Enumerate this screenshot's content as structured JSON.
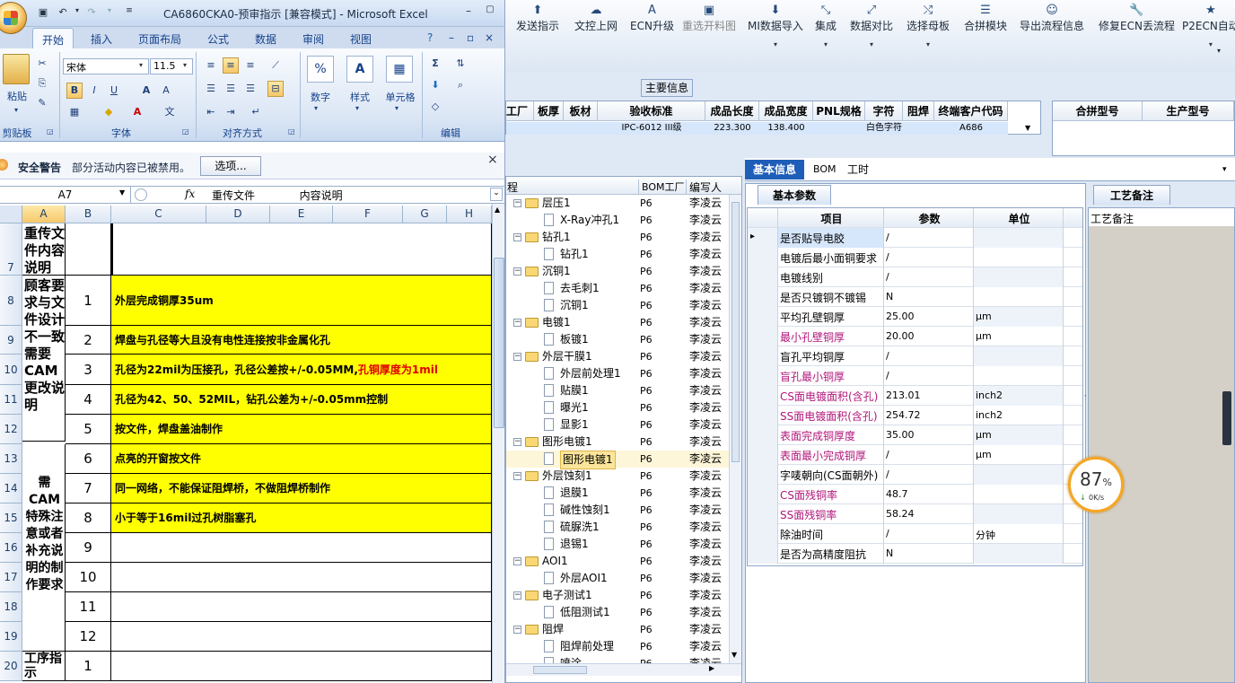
{
  "excel": {
    "title": "CA6860CKA0-预审指示  [兼容模式] - Microsoft Excel",
    "tabs": [
      "开始",
      "插入",
      "页面布局",
      "公式",
      "数据",
      "审阅",
      "视图"
    ],
    "font_name": "宋体",
    "font_size": "11.5",
    "groups": {
      "clipboard": "剪贴板",
      "font": "字体",
      "align": "对齐方式",
      "number": "数字",
      "style": "样式",
      "cells": "单元格",
      "edit": "编辑"
    },
    "paste": "粘贴",
    "security": {
      "label": "安全警告",
      "text": "部分活动内容已被禁用。",
      "button": "选项..."
    },
    "namebox": "A7",
    "fx": "fx",
    "formula": "重传文件             内容说明",
    "columns": [
      "A",
      "B",
      "C",
      "D",
      "E",
      "F",
      "G",
      "H"
    ],
    "row_numbers": [
      "7",
      "8",
      "9",
      "10",
      "11",
      "12",
      "13",
      "14",
      "15",
      "16",
      "17",
      "18",
      "19",
      "20"
    ],
    "a7": "重传文件内容说明",
    "a8": "顾客要求与文件设计不一致需要CAM更改说明",
    "a13": "需CAM特殊注意或者补充说明的制作要求",
    "a20": "工序指示",
    "numbers": [
      "1",
      "2",
      "3",
      "4",
      "5",
      "6",
      "7",
      "8",
      "9",
      "10",
      "11",
      "12",
      "1"
    ],
    "c8": "外层完成铜厚35um",
    "c9": "焊盘与孔径等大且没有电性连接按非金属化孔",
    "c10a": "孔径为22mil为压接孔，孔径公差按+/-0.05MM,",
    "c10b": "孔铜厚度为1mil",
    "c11": "孔径为42、50、52MIL，钻孔公差为+/-0.05mm控制",
    "c12": "按文件，焊盘盖油制作",
    "c13": "点亮的开窗按文件",
    "c14": "同一网络，不能保证阻焊桥，不做阻焊桥制作",
    "c15": "小于等于16mil过孔树脂塞孔"
  },
  "mes": {
    "toolbar": [
      "发送指示",
      "文控上网",
      "ECN升级",
      "重选开料图",
      "MI数据导入",
      "集成",
      "数据对比",
      "选择母板",
      "合拼模块",
      "导出流程信息",
      "修复ECN丢流程",
      "P2ECN自动"
    ],
    "main_info": "主要信息",
    "headers": [
      "工厂",
      "板厚",
      "板材",
      "验收标准",
      "成品长度",
      "成品宽度",
      "PNL规格",
      "字符",
      "阻焊",
      "终端客户代码"
    ],
    "row": [
      "",
      "",
      "",
      "IPC-6012 III级",
      "223.300",
      "138.400",
      "",
      "白色字符",
      "",
      "A686"
    ],
    "headers2": [
      "合拼型号",
      "生产型号"
    ],
    "tree_headers": [
      "程",
      "BOM工厂",
      "编写人"
    ],
    "tree": [
      {
        "n": "层压1",
        "l": 0
      },
      {
        "n": "X-Ray冲孔1",
        "l": 1
      },
      {
        "n": "钻孔1",
        "l": 0
      },
      {
        "n": "钻孔1",
        "l": 1
      },
      {
        "n": "沉铜1",
        "l": 0
      },
      {
        "n": "去毛刺1",
        "l": 1
      },
      {
        "n": "沉铜1",
        "l": 1
      },
      {
        "n": "电镀1",
        "l": 0
      },
      {
        "n": "板镀1",
        "l": 1
      },
      {
        "n": "外层干膜1",
        "l": 0
      },
      {
        "n": "外层前处理1",
        "l": 1
      },
      {
        "n": "贴膜1",
        "l": 1
      },
      {
        "n": "曝光1",
        "l": 1
      },
      {
        "n": "显影1",
        "l": 1
      },
      {
        "n": "图形电镀1",
        "l": 0
      },
      {
        "n": "图形电镀1",
        "l": 1,
        "sel": true
      },
      {
        "n": "外层蚀刻1",
        "l": 0
      },
      {
        "n": "退膜1",
        "l": 1
      },
      {
        "n": "碱性蚀刻1",
        "l": 1
      },
      {
        "n": "硫脲洗1",
        "l": 1
      },
      {
        "n": "退锡1",
        "l": 1
      },
      {
        "n": "AOI1",
        "l": 0
      },
      {
        "n": "外层AOI1",
        "l": 1
      },
      {
        "n": "电子测试1",
        "l": 0
      },
      {
        "n": "低阻测试1",
        "l": 1
      },
      {
        "n": "阻焊",
        "l": 0
      },
      {
        "n": "阻焊前处理",
        "l": 1
      },
      {
        "n": "喷涂",
        "l": 1
      }
    ],
    "bom": "P6",
    "user": "李凌云",
    "prop_tabs": [
      "基本信息",
      "BOM",
      "工时"
    ],
    "basic_params": "基本参数",
    "remarks_tab": "工艺备注",
    "remarks_label": "工艺备注",
    "prop_headers": [
      "项目",
      "参数",
      "单位"
    ],
    "props": [
      [
        "是否贴导电胶",
        "/",
        "",
        0
      ],
      [
        "电镀后最小面铜要求",
        "/",
        "",
        0
      ],
      [
        "电镀线别",
        "/",
        "",
        0
      ],
      [
        "是否只镀铜不镀锡",
        "N",
        "",
        0
      ],
      [
        "平均孔壁铜厚",
        "25.00",
        "μm",
        0
      ],
      [
        "最小孔壁铜厚",
        "20.00",
        "μm",
        1
      ],
      [
        "盲孔平均铜厚",
        "/",
        "",
        0
      ],
      [
        "盲孔最小铜厚",
        "/",
        "",
        1
      ],
      [
        "CS面电镀面积(含孔)",
        "213.01",
        "inch2",
        1
      ],
      [
        "SS面电镀面积(含孔)",
        "254.72",
        "inch2",
        1
      ],
      [
        "表面完成铜厚度",
        "35.00",
        "μm",
        1
      ],
      [
        "表面最小完成铜厚",
        "/",
        "μm",
        1
      ],
      [
        "字唛朝向(CS面朝外)",
        "/",
        "",
        0
      ],
      [
        "CS面残铜率",
        "48.7",
        "",
        1
      ],
      [
        "SS面残铜率",
        "58.24",
        "",
        1
      ],
      [
        "除油时间",
        "/",
        "分钟",
        0
      ],
      [
        "是否为高精度阻抗",
        "N",
        "",
        0
      ]
    ],
    "speed": {
      "pct": "87",
      "unit": "%",
      "rate": "0K/s"
    }
  }
}
